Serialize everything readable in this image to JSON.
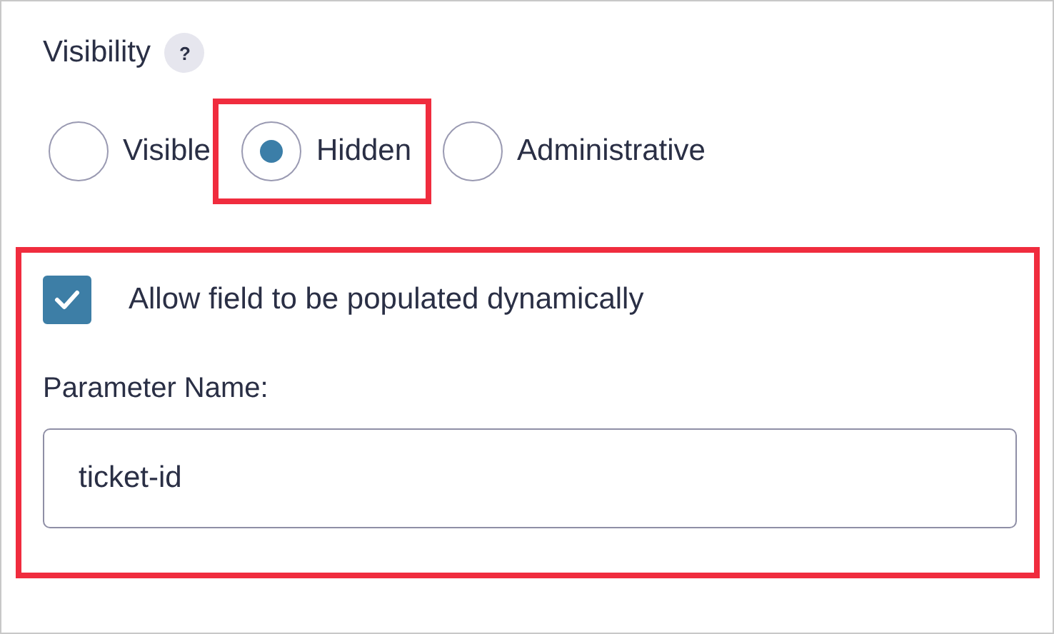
{
  "visibility": {
    "label": "Visibility",
    "help": "?",
    "options": [
      {
        "label": "Visible",
        "selected": false,
        "highlighted": false
      },
      {
        "label": "Hidden",
        "selected": true,
        "highlighted": true
      },
      {
        "label": "Administrative",
        "selected": false,
        "highlighted": false
      }
    ]
  },
  "dynamic": {
    "highlighted": true,
    "checkbox": {
      "label": "Allow field to be populated dynamically",
      "checked": true
    },
    "parameter": {
      "label": "Parameter Name:",
      "value": "ticket-id"
    }
  }
}
